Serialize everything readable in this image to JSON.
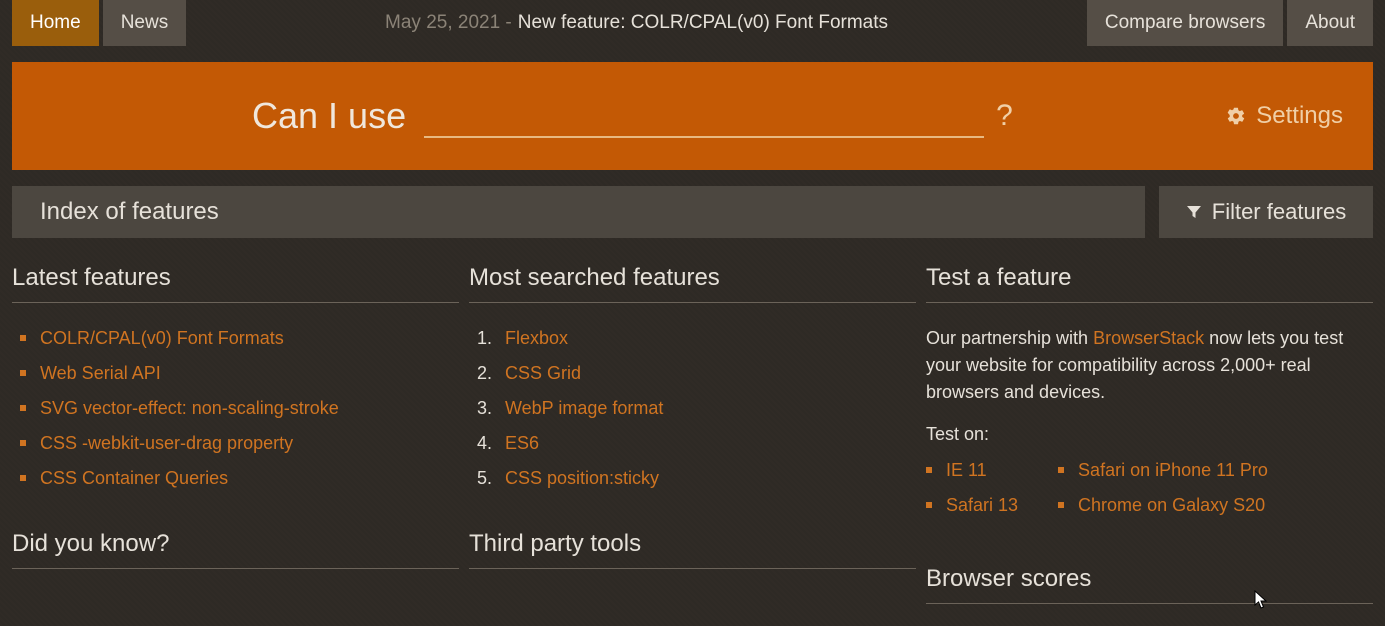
{
  "nav": {
    "home": "Home",
    "news": "News",
    "compare": "Compare browsers",
    "about": "About"
  },
  "newsline": {
    "date": "May 25, 2021 -",
    "text": "New feature: COLR/CPAL(v0) Font Formats"
  },
  "search": {
    "brand": "Can I use",
    "placeholder": "",
    "help": "?",
    "settings": "Settings"
  },
  "index": {
    "title": "Index of features",
    "filter": "Filter features"
  },
  "latest": {
    "heading": "Latest features",
    "items": [
      "COLR/CPAL(v0) Font Formats",
      "Web Serial API",
      "SVG vector-effect: non-scaling-stroke",
      "CSS -webkit-user-drag property",
      "CSS Container Queries"
    ]
  },
  "most": {
    "heading": "Most searched features",
    "items": [
      "Flexbox",
      "CSS Grid",
      "WebP image format",
      "ES6",
      "CSS position:sticky"
    ]
  },
  "test": {
    "heading": "Test a feature",
    "text_pre": "Our partnership with ",
    "link": "BrowserStack",
    "text_post": " now lets you test your website for compatibility across 2,000+ real browsers and devices.",
    "teston": "Test on:",
    "col1": [
      "IE 11",
      "Safari 13"
    ],
    "col2": [
      "Safari on iPhone 11 Pro",
      "Chrome on Galaxy S20"
    ]
  },
  "lower": {
    "didyou": "Did you know?",
    "third": "Third party tools",
    "scores": "Browser scores"
  }
}
